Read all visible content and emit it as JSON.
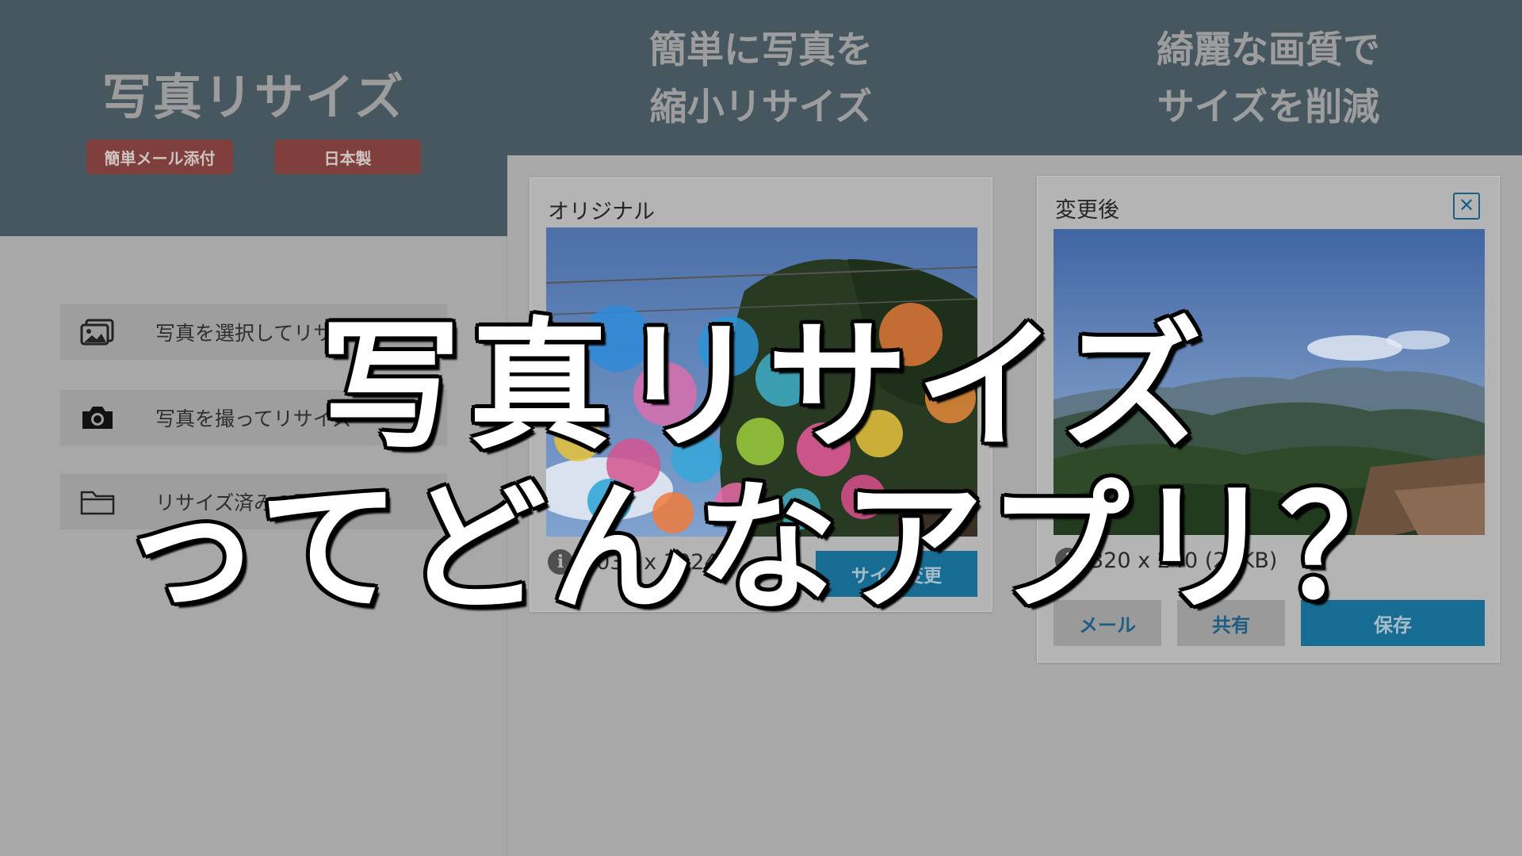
{
  "left": {
    "title": "写真リサイズ",
    "badges": [
      "簡単メール添付",
      "日本製"
    ],
    "menu": [
      {
        "label": "写真を選択してリサイズ",
        "icon": "photos-icon"
      },
      {
        "label": "写真を撮ってリサイズ",
        "icon": "camera-icon"
      },
      {
        "label": "リサイズ済みの写真を見る",
        "icon": "folder-icon"
      }
    ]
  },
  "middle": {
    "header_line1": "簡単に写真を",
    "header_line2": "縮小リサイズ",
    "card_title": "オリジナル",
    "dimensions": "4032 x 3024",
    "resize_button": "サイズ変更"
  },
  "right": {
    "header_line1": "綺麗な画質で",
    "header_line2": "サイズを削減",
    "card_title": "変更後",
    "dimensions": "320 x 240 (23KB)",
    "mail_button": "メール",
    "share_button": "共有",
    "save_button": "保存"
  },
  "overlay": {
    "line1": "写真リサイズ",
    "line2": "ってどんなアプリ？"
  },
  "colors": {
    "header_bg": "#465760",
    "accent": "#166c93",
    "badge": "#7f3f3c"
  }
}
